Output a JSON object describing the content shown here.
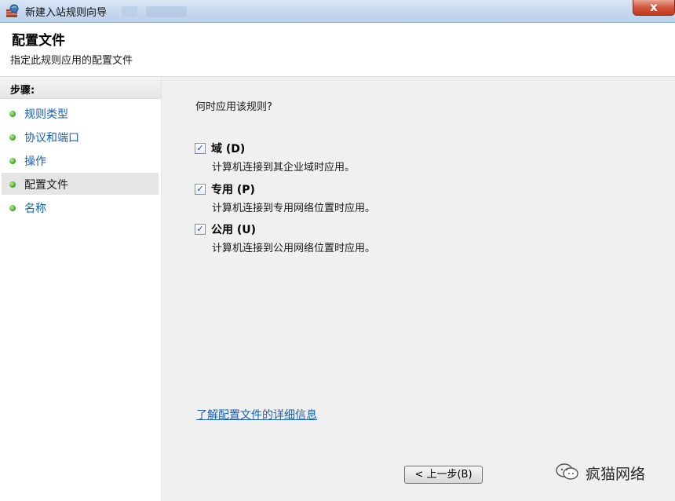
{
  "window": {
    "title": "新建入站规则向导",
    "close_label": "x"
  },
  "header": {
    "title": "配置文件",
    "subtitle": "指定此规则应用的配置文件"
  },
  "sidebar": {
    "title": "步骤:",
    "items": [
      {
        "label": "规则类型",
        "active": false
      },
      {
        "label": "协议和端口",
        "active": false
      },
      {
        "label": "操作",
        "active": false
      },
      {
        "label": "配置文件",
        "active": true
      },
      {
        "label": "名称",
        "active": false
      }
    ]
  },
  "main": {
    "question": "何时应用该规则?",
    "options": [
      {
        "label": "域 (D)",
        "desc": "计算机连接到其企业域时应用。",
        "checked": true
      },
      {
        "label": "专用 (P)",
        "desc": "计算机连接到专用网络位置时应用。",
        "checked": true
      },
      {
        "label": "公用 (U)",
        "desc": "计算机连接到公用网络位置时应用。",
        "checked": true
      }
    ],
    "info_link": "了解配置文件的详细信息",
    "back_button": "< 上一步(B)"
  },
  "watermark": {
    "text": "疯猫网络"
  },
  "icons": {
    "check": "✓",
    "app": "firewall-icon",
    "watermark_logo": "wechat-icon"
  },
  "colors": {
    "link": "#1a5fb4",
    "step_dot": "#3da121",
    "close": "#c2391c"
  }
}
